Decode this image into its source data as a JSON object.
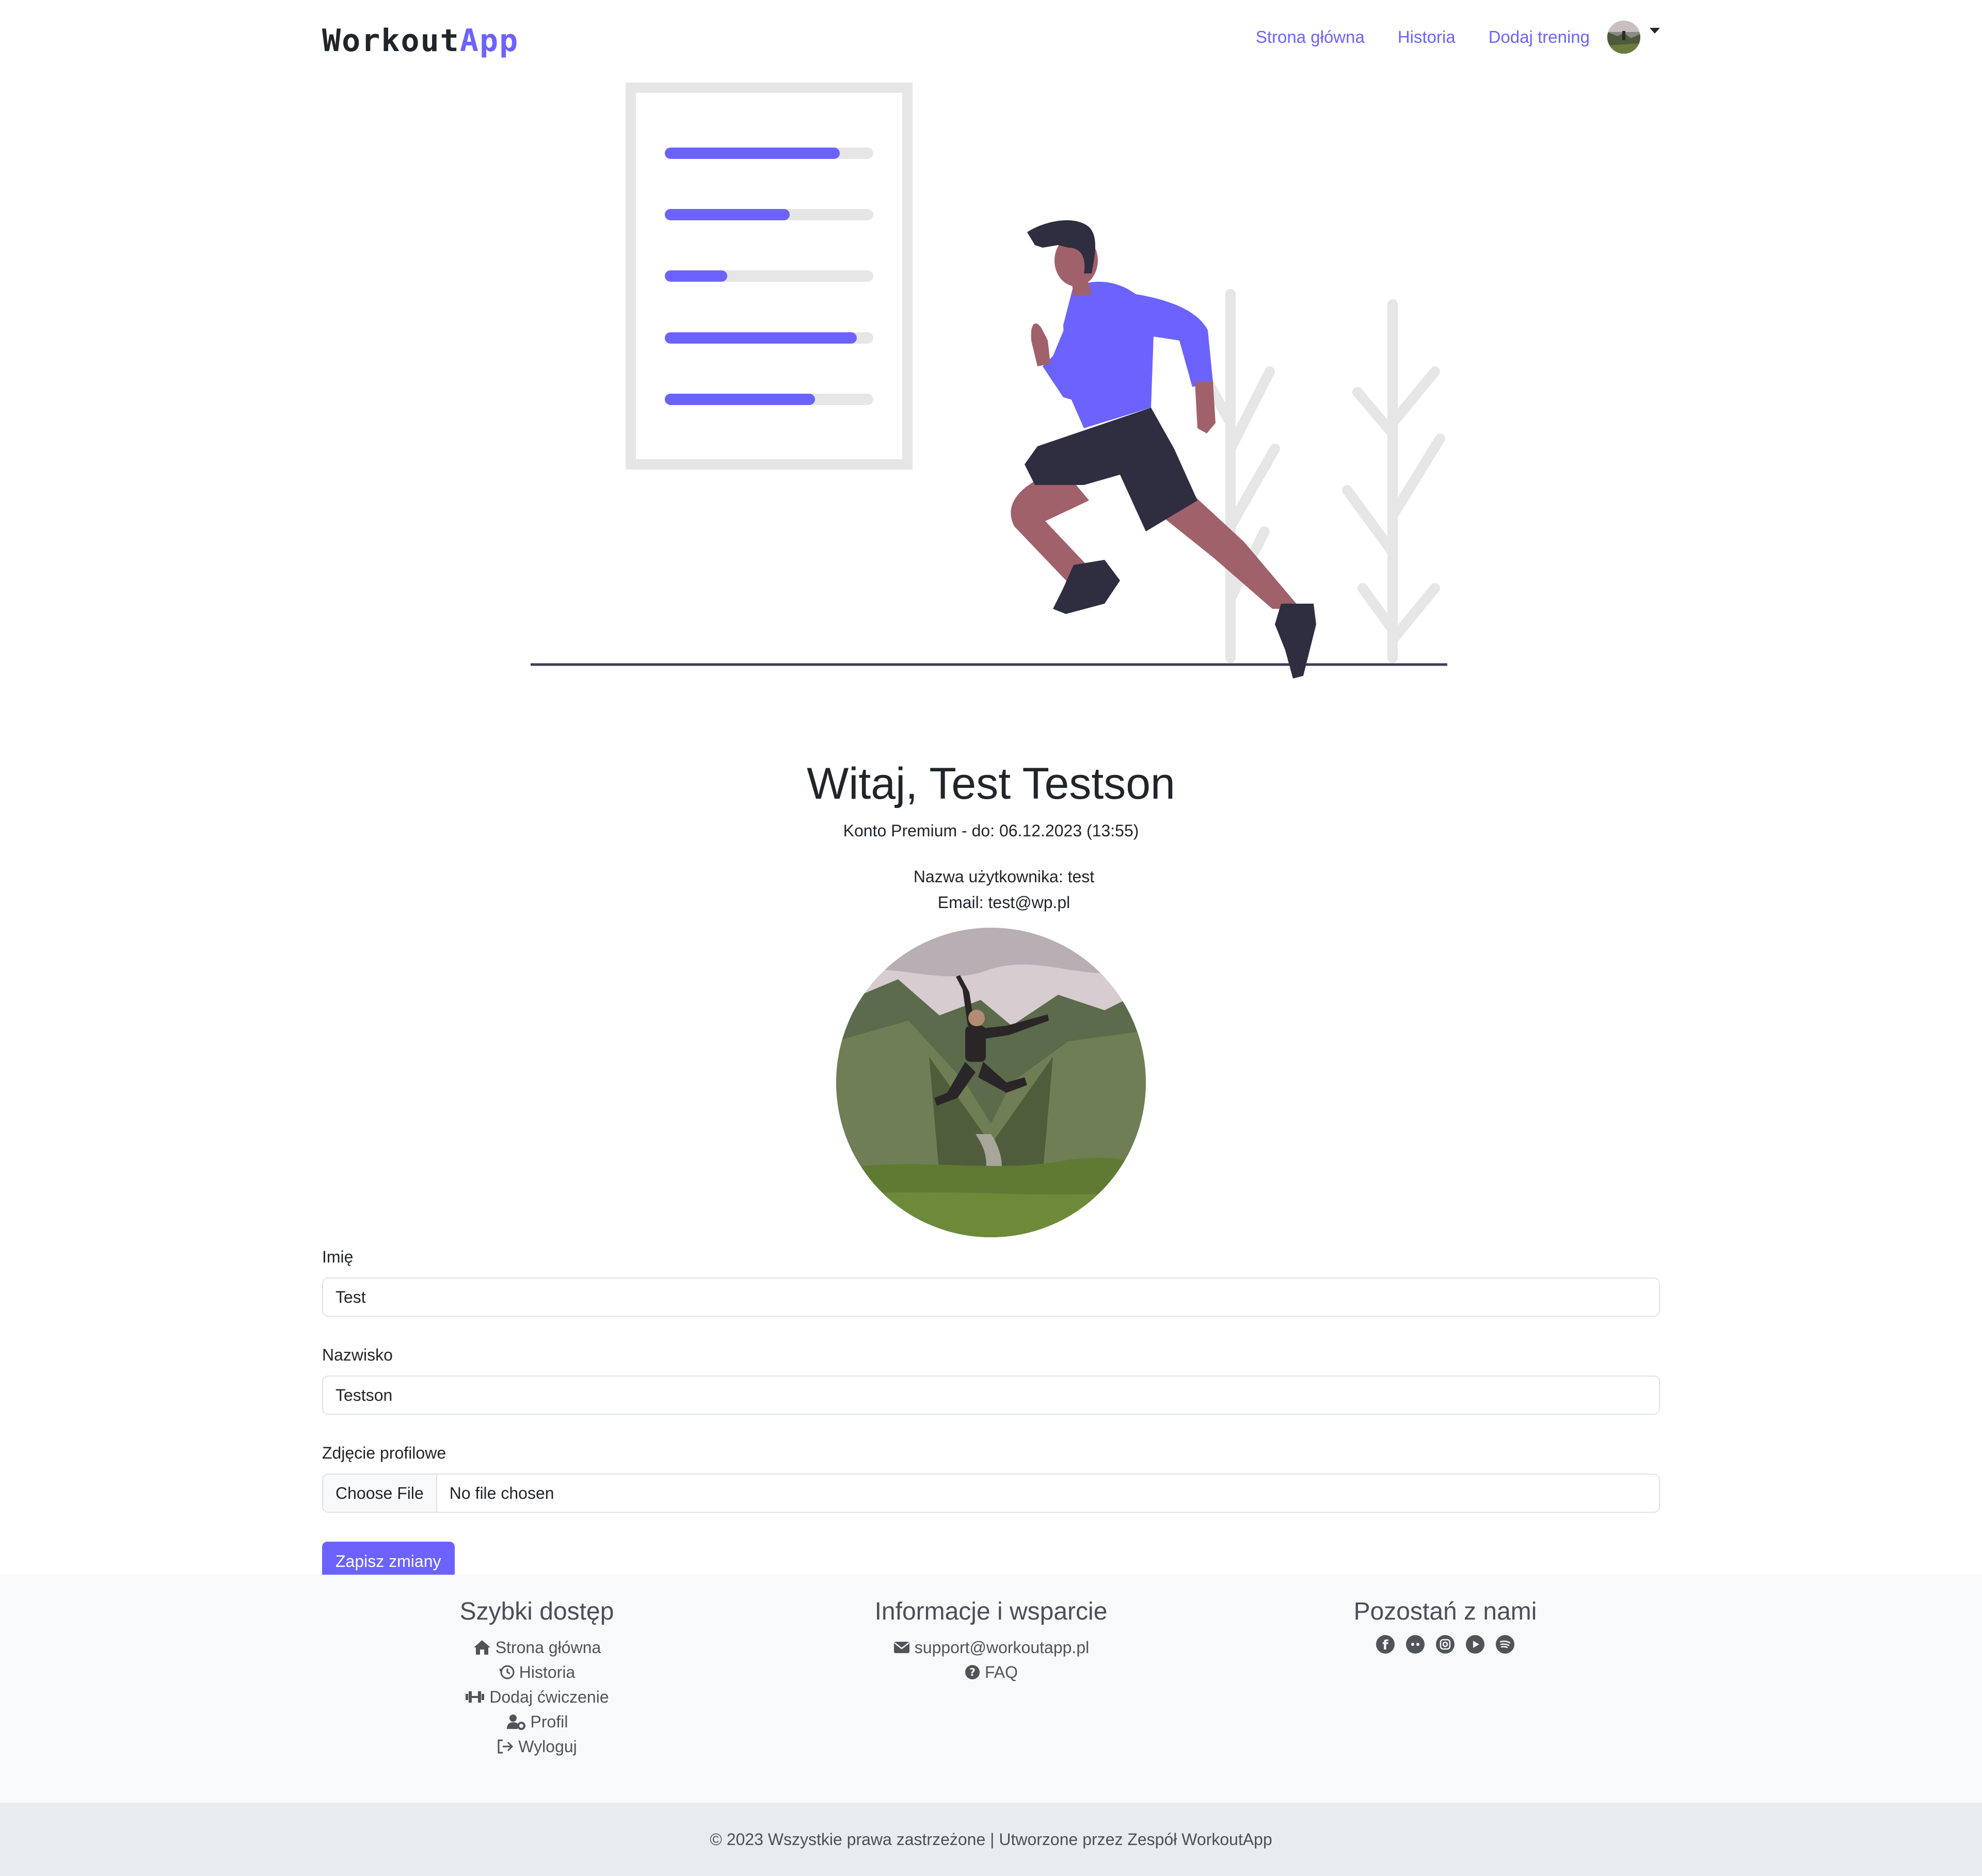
{
  "nav": {
    "logo_part1": "Workout",
    "logo_part2": "App",
    "links": [
      "Strona główna",
      "Historia",
      "Dodaj trening"
    ]
  },
  "profile": {
    "greeting": "Witaj, Test Testson",
    "premium": "Konto Premium - do: 06.12.2023 (13:55)",
    "username_line": "Nazwa użytkownika: test",
    "email_line": "Email: test@wp.pl"
  },
  "form": {
    "first_name_label": "Imię",
    "first_name_value": "Test",
    "last_name_label": "Nazwisko",
    "last_name_value": "Testson",
    "photo_label": "Zdjęcie profilowe",
    "file_button": "Choose File",
    "file_status": "No file chosen",
    "save_label": "Zapisz zmiany"
  },
  "hero": {
    "progress_levels": [
      0.84,
      0.6,
      0.3,
      0.92,
      0.72
    ]
  },
  "footer": {
    "quick_title": "Szybki dostęp",
    "quick_links": [
      {
        "label": "Strona główna",
        "icon": "home-icon"
      },
      {
        "label": "Historia",
        "icon": "history-icon"
      },
      {
        "label": "Dodaj ćwiczenie",
        "icon": "dumbbell-icon"
      },
      {
        "label": "Profil",
        "icon": "user-gear-icon"
      },
      {
        "label": "Wyloguj",
        "icon": "logout-icon"
      }
    ],
    "info_title": "Informacje i wsparcie",
    "info_links": [
      {
        "label": "support@workoutapp.pl",
        "icon": "envelope-icon"
      },
      {
        "label": "FAQ",
        "icon": "question-icon"
      }
    ],
    "social_title": "Pozostań z nami",
    "social_icons": [
      "facebook-icon",
      "discord-icon",
      "instagram-icon",
      "youtube-icon",
      "spotify-icon"
    ],
    "copyright": "© 2023 Wszystkie prawa zastrzeżone | Utworzone przez Zespół WorkoutApp"
  },
  "colors": {
    "accent": "#6c63ff",
    "footer_bg": "#f8f9fa",
    "copyright_bg": "#e9ecef"
  }
}
